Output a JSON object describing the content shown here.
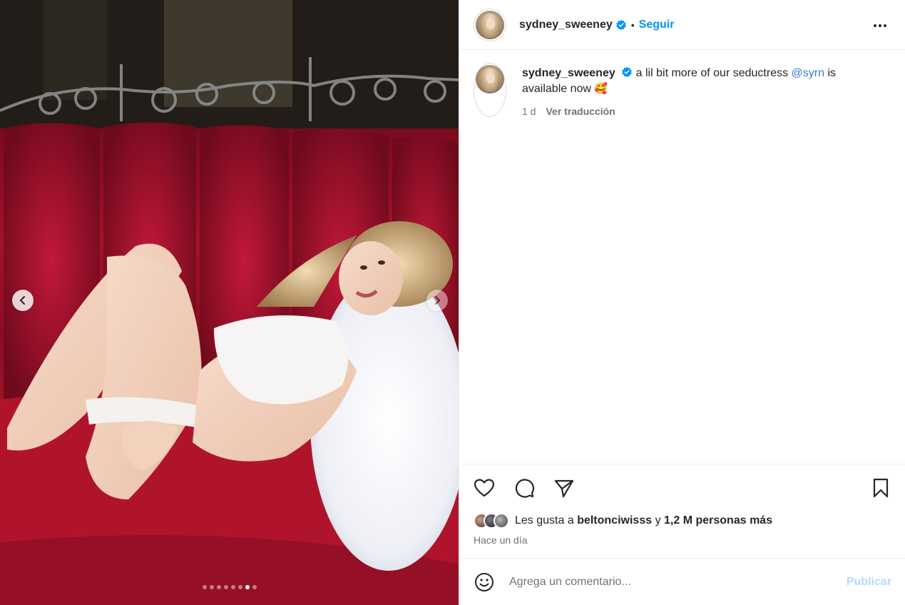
{
  "post": {
    "username": "sydney_sweeney",
    "follow_label": "Seguir",
    "separator": "•",
    "caption_before": "a lil bit more of our seductress",
    "mention": "@syrn",
    "caption_after": "is available now",
    "caption_emoji": "🥰",
    "age": "1 d",
    "translate_label": "Ver traducción"
  },
  "likes": {
    "prefix": "Les gusta a",
    "first_liker": "beltonciwisss",
    "connector": "y",
    "others": "1,2 M personas más",
    "posted": "Hace un día"
  },
  "comment": {
    "placeholder": "Agrega un comentario...",
    "publish_label": "Publicar"
  },
  "carousel": {
    "total_slides": 8,
    "active_slide": 7
  },
  "colors": {
    "accent": "#0095f6",
    "mention": "#3c78d8",
    "publish_disabled": "#b3dbff",
    "velvet": "#a3122a"
  },
  "icons": [
    "chevron-left-icon",
    "chevron-right-icon",
    "verified-badge-icon",
    "more-options-icon",
    "heart-icon",
    "comment-icon",
    "share-icon",
    "bookmark-icon",
    "emoji-icon"
  ]
}
